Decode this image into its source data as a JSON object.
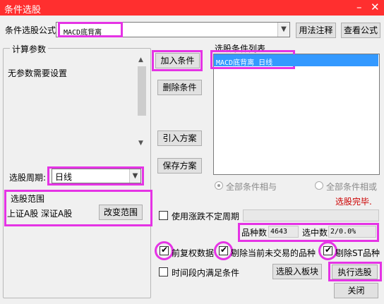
{
  "window": {
    "title": "条件选股",
    "min_glyph": "–",
    "close_glyph": "✕"
  },
  "formula": {
    "label": "条件选股公式",
    "value": "MACD底背离",
    "usage_button": "用法注释",
    "view_button": "查看公式"
  },
  "params": {
    "title": "计算参数",
    "text": "无参数需要设置"
  },
  "period": {
    "label": "选股周期:",
    "value": "日线"
  },
  "range": {
    "title": "选股范围",
    "markets": "上证A股 深证A股",
    "change_button": "改变范围"
  },
  "buttons": {
    "add": "加入条件",
    "delete": "删除条件",
    "import": "引入方案",
    "save": "保存方案",
    "to_block": "选股入板块",
    "execute": "执行选股",
    "close": "关闭"
  },
  "condition_list": {
    "title": "选股条件列表",
    "items": [
      "MACD底背离  日线"
    ]
  },
  "logic": {
    "and_label": "全部条件相与",
    "or_label": "全部条件相或",
    "status": "选股完毕."
  },
  "options": {
    "variable_period": "使用涨跌不定周期",
    "forward_adjust": "前复权数据",
    "exclude_untraded": "剔除当前未交易的品种",
    "exclude_st": "剔除ST品种",
    "time_range": "时间段内满足条件"
  },
  "stats": {
    "count_label": "品种数",
    "count_value": "4643",
    "selected_label": "选中数",
    "selected_value": "2/0.0%"
  },
  "icons": {
    "dropdown": "▼",
    "scroll_up": "▲",
    "scroll_down": "▼",
    "check": "✔"
  },
  "colors": {
    "title_bar": "#ff2f2f",
    "highlight": "#e533e5",
    "selection": "#3399ff",
    "status_text": "#cc0000"
  }
}
